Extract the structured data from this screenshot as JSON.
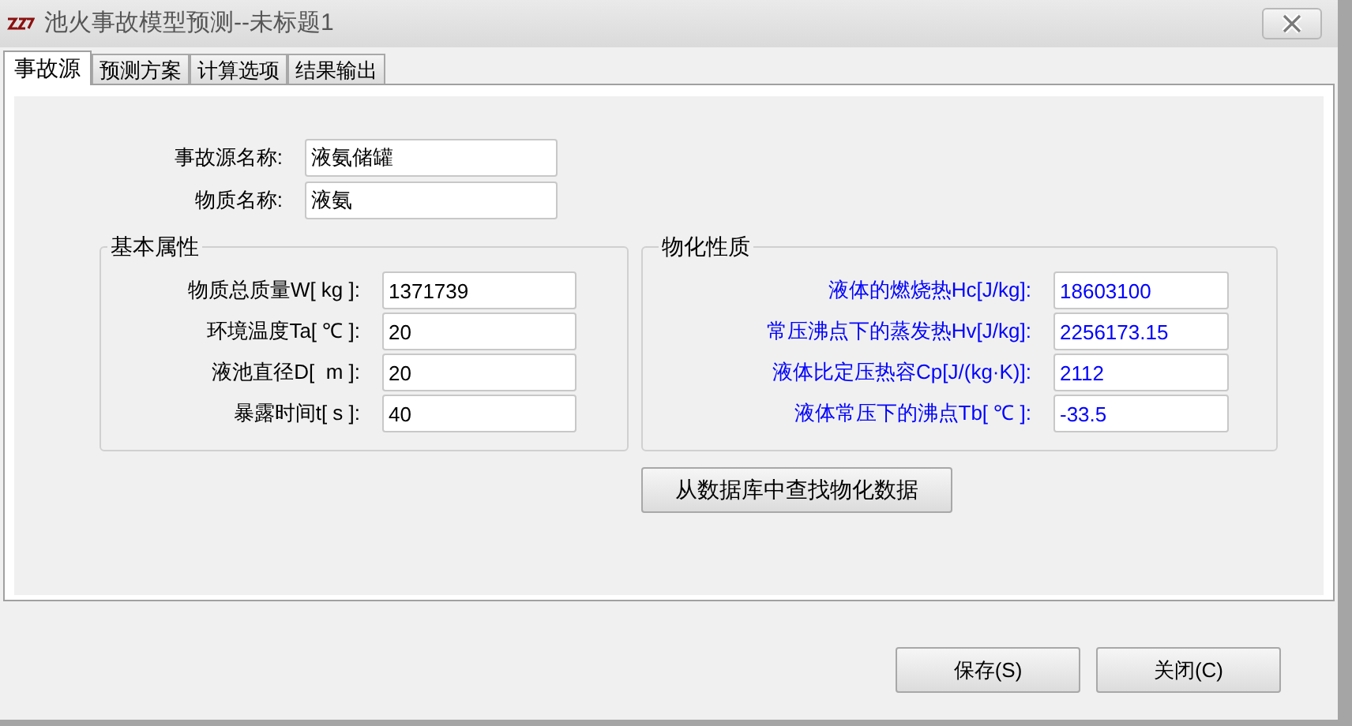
{
  "window": {
    "title": "池火事故模型预测--未标题1"
  },
  "tabs": [
    {
      "label": "事故源",
      "selected": true
    },
    {
      "label": "预测方案",
      "selected": false
    },
    {
      "label": "计算选项",
      "selected": false
    },
    {
      "label": "结果输出",
      "selected": false
    }
  ],
  "source_fields": [
    {
      "label": "事故源名称:",
      "value": "液氨储罐"
    },
    {
      "label": "物质名称:",
      "value": "液氨"
    }
  ],
  "groups": [
    {
      "title": "基本属性",
      "color": "#000000",
      "fields": [
        {
          "label": "物质总质量W[ kg ]:",
          "value": "1371739"
        },
        {
          "label": "环境温度Ta[ ℃ ]:",
          "value": "20"
        },
        {
          "label": "液池直径D[  m ]:",
          "value": "20"
        },
        {
          "label": "暴露时间t[ s ]:",
          "value": "40"
        }
      ]
    },
    {
      "title": "物化性质",
      "color": "#0000ff",
      "fields": [
        {
          "label": "液体的燃烧热Hc[J/kg]:",
          "value": "18603100"
        },
        {
          "label": "常压沸点下的蒸发热Hv[J/kg]:",
          "value": "2256173.15"
        },
        {
          "label": "液体比定压热容Cp[J/(kg·K)]:",
          "value": "2112"
        },
        {
          "label": "液体常压下的沸点Tb[ ℃ ]:",
          "value": "-33.5"
        }
      ]
    }
  ],
  "lookup_button": "从数据库中查找物化数据",
  "buttons": [
    "保存(S)",
    "关闭(C)"
  ]
}
